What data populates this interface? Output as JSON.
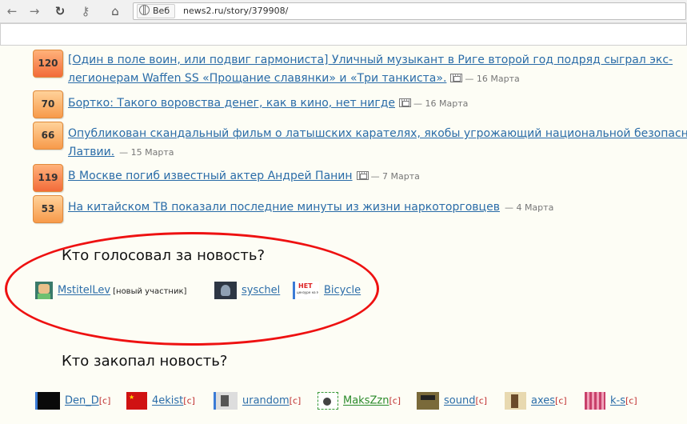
{
  "browser": {
    "back_icon": "←",
    "forward_icon": "→",
    "reload_icon": "↻",
    "key_icon": "⚷",
    "home_icon": "⌂",
    "site_label": "Веб",
    "url": "news2.ru/story/379908/"
  },
  "related_news": [
    {
      "score": "120",
      "title": "[Один в поле воин, или подвиг гармониста] Уличный музыкант в Риге второй год подряд сыграл экс-",
      "title2": "легионерам Waffen SS «Прощание славянки» и «Три танкиста».",
      "date": "— 16 Марта"
    },
    {
      "score": "70",
      "title": "Бортко: Такого воровства денег, как в кино, нет нигде",
      "date": "— 16 Марта"
    },
    {
      "score": "66",
      "title": "Опубликован скандальный фильм о латышских карателях, якобы угрожающий национальной безопасн",
      "title2": "Латвии.",
      "date": "— 15 Марта"
    },
    {
      "score": "119",
      "title": "В Москве погиб известный актер Андрей Панин",
      "date": "— 7 Марта"
    },
    {
      "score": "53",
      "title": "На китайском ТВ показали последние минуты из жизни наркоторговцев",
      "date": "— 4 Марта"
    }
  ],
  "voted_for": {
    "heading": "Кто голосовал за новость?",
    "users": [
      {
        "name": "MstitelLev",
        "note": "[новый участник]"
      },
      {
        "name": "syschel"
      },
      {
        "name": "Bicycle",
        "avatar_text": "НЕТ",
        "avatar_sub": "цензуре на №21"
      }
    ]
  },
  "voted_against": {
    "heading": "Кто закопал новость?",
    "users": [
      {
        "name": "Den_D",
        "tag": "[c]"
      },
      {
        "name": "4ekist",
        "tag": "[c]"
      },
      {
        "name": "urandom",
        "tag": "[c]"
      },
      {
        "name": "MaksZzn",
        "tag": "[c]"
      },
      {
        "name": "sound",
        "tag": "[c]"
      },
      {
        "name": "axes",
        "tag": "[c]"
      },
      {
        "name": "k-s",
        "tag": "[c]"
      }
    ]
  }
}
